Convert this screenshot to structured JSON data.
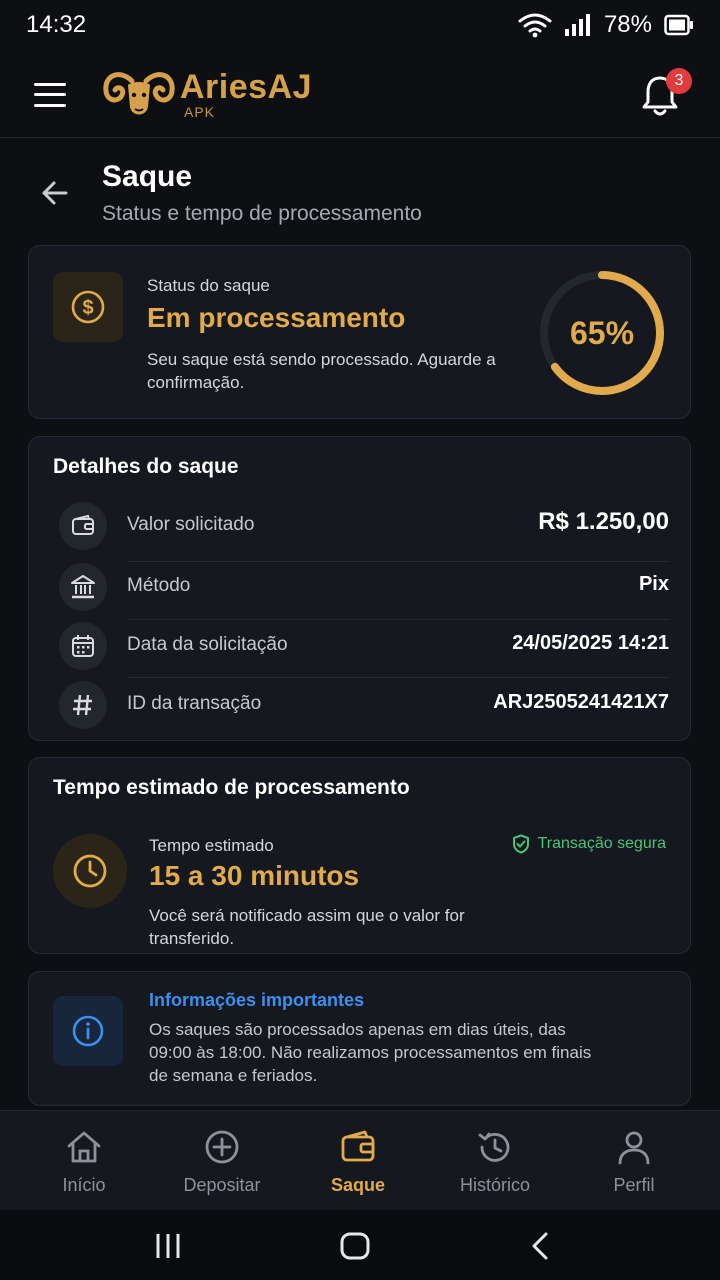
{
  "status_bar": {
    "time": "14:32",
    "battery": "78%"
  },
  "header": {
    "brand_name": "AriesAJ",
    "brand_sub": "APK",
    "notification_count": "3"
  },
  "page": {
    "title": "Saque",
    "subtitle": "Status e tempo de processamento"
  },
  "status_card": {
    "label": "Status do saque",
    "value": "Em processamento",
    "description": "Seu saque está sendo processado. Aguarde a confirmação.",
    "progress_text": "65%",
    "progress": 0.65
  },
  "details": {
    "title": "Detalhes do saque",
    "rows": [
      {
        "icon": "wallet-icon",
        "label": "Valor solicitado",
        "value": "R$ 1.250,00"
      },
      {
        "icon": "bank-icon",
        "label": "Método",
        "value": "Pix"
      },
      {
        "icon": "calendar-icon",
        "label": "Data da solicitação",
        "value": "24/05/2025 14:21"
      },
      {
        "icon": "hash-icon",
        "label": "ID da transação",
        "value": "ARJ2505241421X7"
      }
    ]
  },
  "time_card": {
    "title": "Tempo estimado de processamento",
    "label": "Tempo estimado",
    "value": "15 a 30 minutos",
    "description": "Você será notificado assim que o valor for transferido.",
    "secure_label": "Transação segura"
  },
  "info_card": {
    "title": "Informações importantes",
    "description": "Os saques são processados apenas em dias úteis, das 09:00 às 18:00. Não realizamos processamentos em finais de semana e feriados."
  },
  "nav": {
    "items": [
      {
        "label": "Início",
        "icon": "home-icon"
      },
      {
        "label": "Depositar",
        "icon": "plus-circle-icon"
      },
      {
        "label": "Saque",
        "icon": "wallet-icon"
      },
      {
        "label": "Histórico",
        "icon": "history-icon"
      },
      {
        "label": "Perfil",
        "icon": "user-icon"
      }
    ],
    "active": "Saque"
  },
  "colors": {
    "accent_gold": "#e0aa4d",
    "secure_green": "#4cc377",
    "info_blue": "#3d8fef",
    "badge_red": "#e23b3b"
  }
}
